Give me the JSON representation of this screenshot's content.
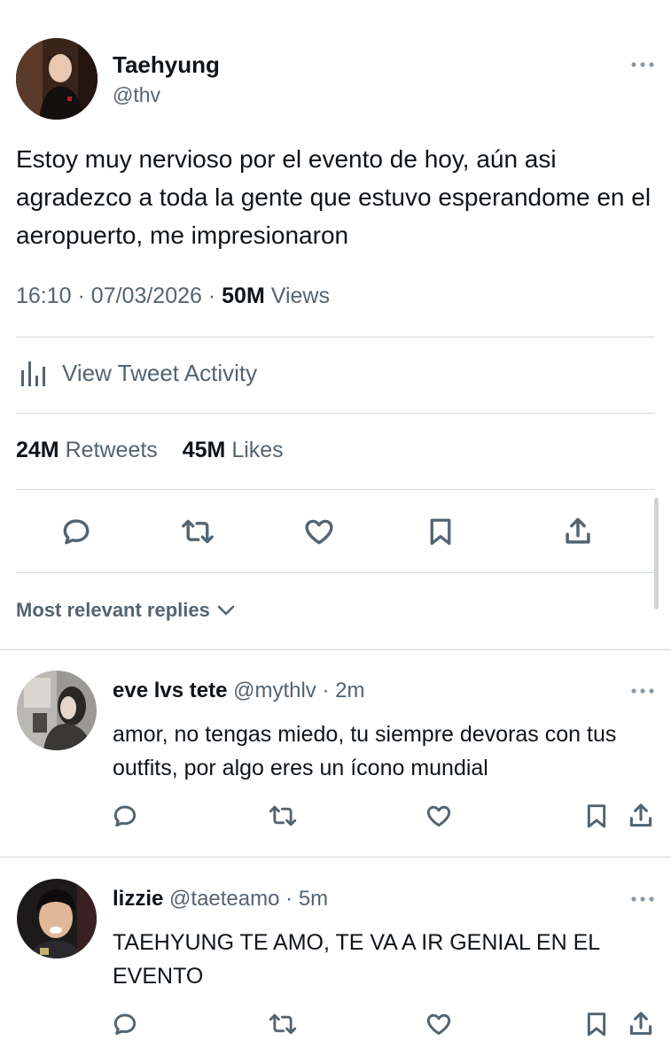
{
  "tweet": {
    "author_name": "Taehyung",
    "author_handle": "@thv",
    "text": "Estoy muy nervioso por el evento de hoy, aún asi agradezco a toda la gente que estuvo esperandome en el aeropuerto, me impresionaron",
    "time": "16:10",
    "separator": "·",
    "date": "07/03/2026",
    "views_count": "50M",
    "views_label": "Views",
    "activity_label": "View Tweet Activity",
    "retweets_count": "24M",
    "retweets_label": "Retweets",
    "likes_count": "45M",
    "likes_label": "Likes",
    "actions": [
      "reply-icon",
      "retweet-icon",
      "like-icon",
      "bookmark-icon",
      "share-icon"
    ]
  },
  "replies_sort_label": "Most relevant replies",
  "replies": [
    {
      "name": "eve lvs tete",
      "handle": "@mythlv",
      "separator": "·",
      "age": "2m",
      "text": "amor, no tengas miedo, tu siempre devoras con tus outfits, por algo eres un ícono mundial"
    },
    {
      "name": "lizzie",
      "handle": "@taeteamo",
      "separator": "·",
      "age": "5m",
      "text": "TAEHYUNG TE AMO, TE VA A IR GENIAL EN EL EVENTO"
    }
  ],
  "colors": {
    "text": "#0f1419",
    "secondary": "#536471",
    "divider": "#cfd9de"
  }
}
